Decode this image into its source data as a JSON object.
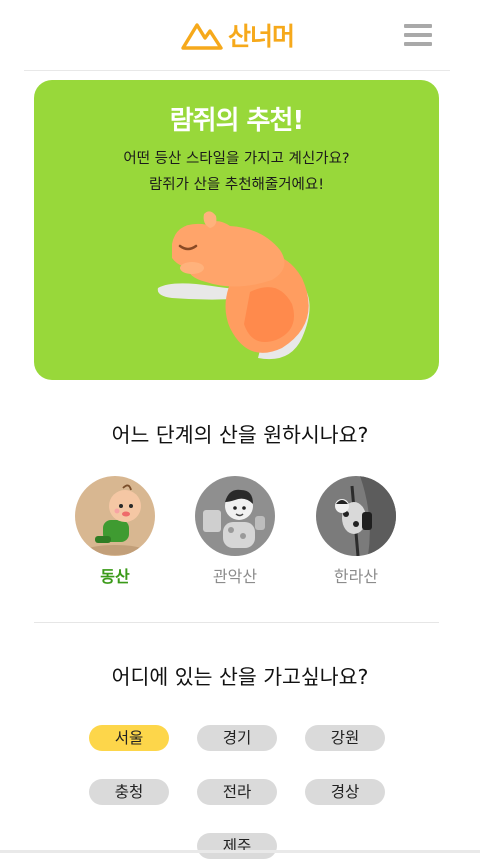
{
  "header": {
    "logo_text": "산너머",
    "menu_icon": "hamburger-menu-icon"
  },
  "hero": {
    "title": "람쥐의 추천!",
    "desc_line1": "어떤 등산 스타일을 가지고 계신가요?",
    "desc_line2": "람쥐가 산을 추천해줄거에요!",
    "background": "#98d83a",
    "mascot": "sleeping-squirrel"
  },
  "level_section": {
    "question": "어느 단계의 산을 원하시나요?",
    "levels": [
      {
        "label": "동산",
        "selected": true
      },
      {
        "label": "관악산",
        "selected": false
      },
      {
        "label": "한라산",
        "selected": false
      }
    ]
  },
  "region_section": {
    "question": "어디에 있는 산을 가고싶나요?",
    "regions": [
      {
        "label": "서울",
        "selected": true
      },
      {
        "label": "경기",
        "selected": false
      },
      {
        "label": "강원",
        "selected": false
      },
      {
        "label": "충청",
        "selected": false
      },
      {
        "label": "전라",
        "selected": false
      },
      {
        "label": "경상",
        "selected": false
      },
      {
        "label": "제주",
        "selected": false
      }
    ]
  },
  "colors": {
    "brand": "#f6a91b",
    "selected_level": "#3a9a18",
    "selected_chip": "#fdd64a",
    "chip": "#dadada"
  }
}
